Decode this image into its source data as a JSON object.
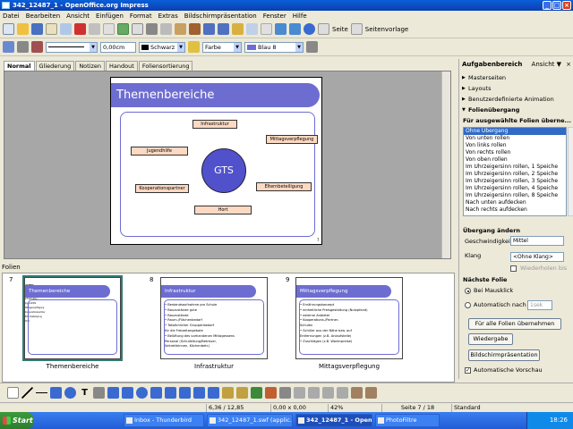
{
  "window": {
    "title": "342_12487_1 - OpenOffice.org Impress",
    "min": "_",
    "max": "□",
    "close": "×"
  },
  "menu": [
    "Datei",
    "Bearbeiten",
    "Ansicht",
    "Einfügen",
    "Format",
    "Extras",
    "Bildschirmpräsentation",
    "Fenster",
    "Hilfe"
  ],
  "toolbar1": {
    "seite_label": "Seite",
    "seitenvorlage_label": "Seitenvorlage"
  },
  "toolbar2": {
    "line_width": "0,00cm",
    "line_color": "Schwarz",
    "fill_type": "Farbe",
    "fill_color": "Blau 8"
  },
  "view_tabs": [
    "Normal",
    "Gliederung",
    "Notizen",
    "Handout",
    "Foliensortierung"
  ],
  "main_slide": {
    "title": "Themenbereiche",
    "center": "GTS",
    "boxes": [
      "Infrastruktur",
      "Jugendhilfe",
      "Mittagsverpflegung",
      "Kooperationspartner",
      "Elternbeteiligung",
      "Hort"
    ],
    "page": "7"
  },
  "slides_panel": {
    "label": "Folien",
    "slides": [
      {
        "num": "7",
        "title": "Themenbereiche",
        "caption": "Themenbereiche"
      },
      {
        "num": "8",
        "title": "Infrastruktur",
        "caption": "Infrastruktur",
        "lines": [
          "• Bestandsaufnahme pro Schule",
          "• Bauzustände gute",
          "• Bauzustände",
          "• Raum-/Flächenbedarf",
          "• Tatsächlicher Gruppenbedarf",
          "   für die Freizeitangebote",
          "• Belüftung des vorhandenen Mittagessens",
          "   Personal (Schulleitung/Betreuer,",
          "   Sekretärinnen, Küchenbetr.)"
        ]
      },
      {
        "num": "9",
        "title": "Mittagsverpflegung",
        "caption": "Mittagsverpflegung",
        "lines": [
          "• Ernährungskonzept",
          "• einheitliche Preisgestaltung (Nutzpfand)",
          "• externe Anbieter",
          "• Kooperations-/Partner-",
          "   Schulen",
          "• Schüler aus der Nähe bzw. auf",
          "   Entfernungen (z.B. Anlaufstelle)",
          "• Zuschlägen (z.B. Warenpreise)"
        ]
      }
    ]
  },
  "task_panel": {
    "title": "Aufgabenbereich",
    "view_menu": "Ansicht ▼",
    "close": "×",
    "sections": [
      "Masterseiten",
      "Layouts",
      "Benutzerdefinierte Animation",
      "Folienübergang"
    ],
    "apply_heading": "Für ausgewählte Folien überne...",
    "transitions": [
      "Ohne Übergang",
      "Von unten rollen",
      "Von links rollen",
      "Von rechts rollen",
      "Von oben rollen",
      "Im Uhrzeigersinn rollen, 1 Speiche",
      "Im Uhrzeigersinn rollen, 2 Speiche",
      "Im Uhrzeigersinn rollen, 3 Speiche",
      "Im Uhrzeigersinn rollen, 4 Speiche",
      "Im Uhrzeigersinn rollen, 8 Speiche",
      "Nach unten aufdecken",
      "Nach rechts aufdecken"
    ],
    "modify_heading": "Übergang ändern",
    "speed_label": "Geschwindigkeit",
    "speed_value": "Mittel",
    "sound_label": "Klang",
    "sound_value": "<Ohne Klang>",
    "repeat_label": "Wiederholen bis",
    "next_heading": "Nächste Folie",
    "on_click": "Bei Mausklick",
    "auto_after": "Automatisch nach",
    "auto_value": "1sek",
    "btn_apply_all": "Für alle Folien übernehmen",
    "btn_play": "Wiedergabe",
    "btn_show": "Bildschirmpräsentation",
    "auto_preview": "Automatische Vorschau"
  },
  "status": {
    "position": "6,36 / 12,85",
    "size": "0,00 x 0,00",
    "zoom": "42%",
    "slide": "Seite 7 / 18",
    "layout": "Standard"
  },
  "taskbar": {
    "start": "Start",
    "tasks": [
      "Inbox - Thunderbird",
      "342_12487_1.swf (applic...",
      "342_12487_1 - Open...",
      "PhotoFiltre"
    ],
    "clock": "18:26"
  },
  "colors": {
    "banner": "#6d6dd1",
    "box_fill": "#fcd9c2",
    "circle": "#5151cc",
    "selection": "#316ac5"
  }
}
